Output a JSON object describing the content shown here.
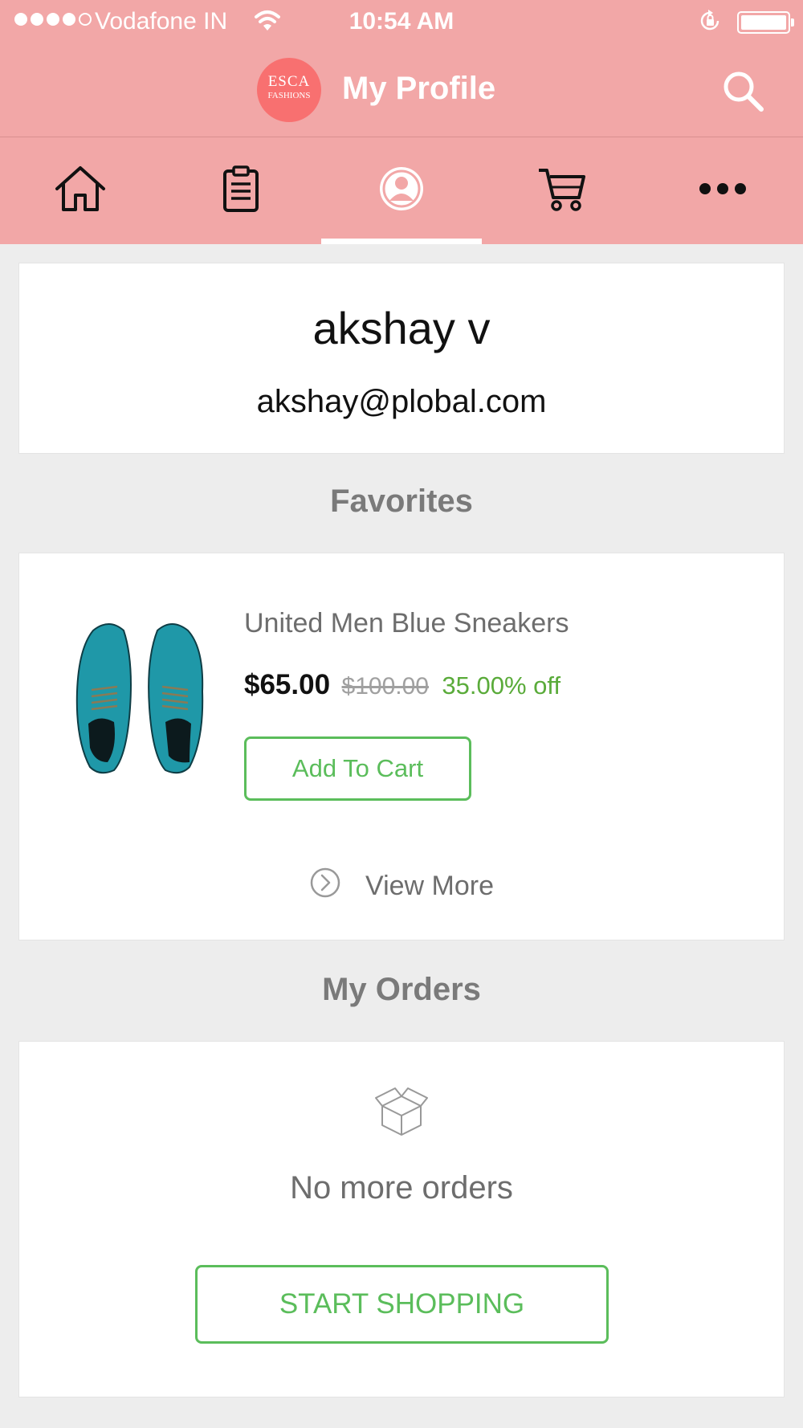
{
  "status_bar": {
    "carrier": "Vodafone IN",
    "time": "10:54 AM",
    "signal_bars_filled": 4,
    "signal_bars_total": 5
  },
  "header": {
    "brand_line1": "ESCA",
    "brand_line2": "FASHIONS",
    "brand_color": "#f87070",
    "title": "My Profile",
    "background": "#f2a7a7"
  },
  "tabs": [
    {
      "icon": "home-icon",
      "active": false
    },
    {
      "icon": "clipboard-icon",
      "active": false
    },
    {
      "icon": "profile-icon",
      "active": true
    },
    {
      "icon": "cart-icon",
      "active": false
    },
    {
      "icon": "more-icon",
      "active": false
    }
  ],
  "user": {
    "name": "akshay v",
    "email": "akshay@plobal.com"
  },
  "favorites": {
    "title": "Favorites",
    "item": {
      "name": "United Men Blue Sneakers",
      "price": "$65.00",
      "old_price": "$100.00",
      "discount": "35.00% off",
      "add_to_cart_label": "Add To Cart"
    },
    "view_more_label": "View More"
  },
  "orders": {
    "title": "My Orders",
    "empty_text": "No more orders",
    "start_shopping_label": "START SHOPPING"
  },
  "colors": {
    "accent_green": "#5bbd5b",
    "discount_green": "#5aab3a",
    "header_pink": "#f2a7a7"
  }
}
